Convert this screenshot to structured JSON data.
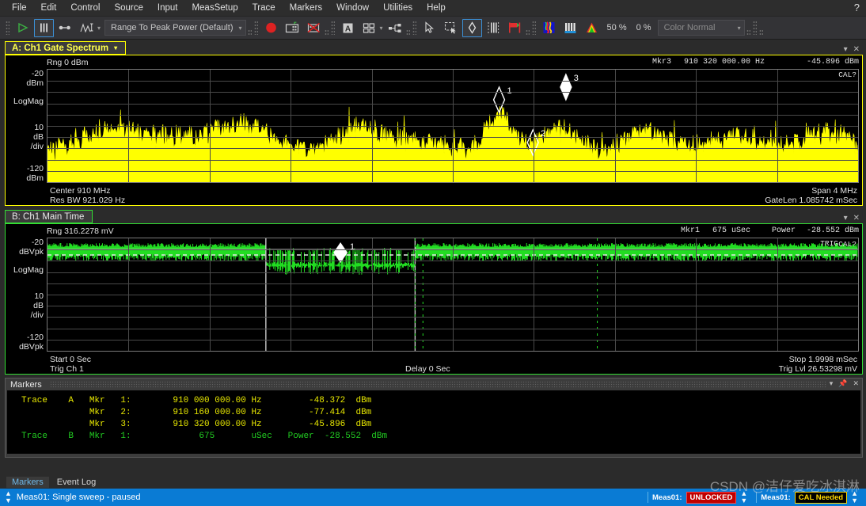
{
  "menu": {
    "items": [
      "File",
      "Edit",
      "Control",
      "Source",
      "Input",
      "MeasSetup",
      "Trace",
      "Markers",
      "Window",
      "Utilities",
      "Help"
    ],
    "help_glyph": "?"
  },
  "toolbar": {
    "play_icon": "play-icon",
    "pause_icon": "pause-icon",
    "single_step_icon": "single-step-icon",
    "range_icon": "autorange-icon",
    "range_dropdown": "Range To Peak Power (Default)",
    "record_icon": "record-icon",
    "capture_icon": "screen-capture-icon",
    "no_capture_icon": "capture-disabled-icon",
    "annotation_icon": "text-annotation-icon",
    "layout_icon": "grid-layout-icon",
    "nodes_icon": "node-network-icon",
    "pointer_icon": "pointer-icon",
    "zoom_box_icon": "zoom-box-icon",
    "marker_icon": "marker-diamond-icon",
    "bars_icon": "bars-icon",
    "gate_icon": "gate-flag-icon",
    "spectrogram_icon": "spectrogram-icon",
    "waterfall_icon": "waterfall-icon",
    "persistence_icon": "persistence-icon",
    "percent_1": "50 %",
    "percent_2": "0 %",
    "color_dropdown": "Color Normal",
    "caret": "▾"
  },
  "panel_a": {
    "tab_label": "A: Ch1 Gate Spectrum",
    "tab_caret": "▾",
    "range": "Rng 0 dBm",
    "marker_readout_label": "Mkr3",
    "marker_readout_freq": "910 320 000.00 Hz",
    "marker_readout_amp": "-45.896 dBm",
    "cal_flag": "CAL?",
    "y_top_1": "-20",
    "y_top_2": "dBm",
    "y_mode": "LogMag",
    "y_div_1": "10",
    "y_div_2": "dB",
    "y_div_3": "/div",
    "y_bot_1": "-120",
    "y_bot_2": "dBm",
    "center": "Center 910 MHz",
    "resbw": "Res BW 921.029  Hz",
    "span": "Span 4 MHz",
    "gatelen": "GateLen 1.085742 mSec",
    "markers": [
      {
        "label": "1",
        "filled": false
      },
      {
        "label": "2",
        "filled": false
      },
      {
        "label": "3",
        "filled": true
      }
    ],
    "minimize_icon": "minimize-icon",
    "close_icon": "close-icon"
  },
  "panel_b": {
    "tab_label": "B: Ch1 Main Time",
    "range": "Rng 316.2278 mV",
    "marker_readout_label": "Mkr1",
    "marker_readout_time": "675 uSec",
    "marker_readout_power_label": "Power",
    "marker_readout_power": "-28.552 dBm",
    "trig_flag": "TRIG",
    "cal_flag": "CAL?",
    "y_top_1": "-20",
    "y_top_2": "dBVpk",
    "y_mode": "LogMag",
    "y_div_1": "10",
    "y_div_2": "dB",
    "y_div_3": "/div",
    "y_bot_1": "-120",
    "y_bot_2": "dBVpk",
    "start": "Start 0  Sec",
    "trig_ch": "Trig Ch 1",
    "delay": "Delay 0  Sec",
    "stop": "Stop 1.9998 mSec",
    "trig_lvl": "Trig Lvl 26.53298 mV",
    "marker_label": "1",
    "minimize_icon": "minimize-icon",
    "close_icon": "close-icon"
  },
  "markers_panel": {
    "title": "Markers",
    "pin_icon": "pin-icon",
    "minimize_icon": "minimize-icon",
    "close_icon": "close-icon",
    "rows": [
      {
        "color": "yellow",
        "text": "Trace    A   Mkr   1:        910 000 000.00 Hz         -48.372  dBm"
      },
      {
        "color": "yellow",
        "text": "             Mkr   2:        910 160 000.00 Hz         -77.414  dBm"
      },
      {
        "color": "yellow",
        "text": "             Mkr   3:        910 320 000.00 Hz         -45.896  dBm"
      },
      {
        "color": "green",
        "text": "Trace    B   Mkr   1:             675       uSec   Power  -28.552  dBm"
      }
    ]
  },
  "bottom_tabs": [
    {
      "label": "Markers",
      "active": true
    },
    {
      "label": "Event Log",
      "active": false
    }
  ],
  "status": {
    "left_text": "Meas01:   Single sweep - paused",
    "updown_icon": "up-down-arrows-icon",
    "badge_1_prefix": "Meas01:",
    "badge_1": "UNLOCKED",
    "badge_2_prefix": "Meas01:",
    "badge_2": "CAL Needed",
    "watermark": "CSDN @洁仔爱吃冰淇淋"
  },
  "colors": {
    "trace_a": "#ffff00",
    "trace_b": "#22dd22",
    "accent": "#0a7bd4",
    "grid": "#4a4a4a",
    "panel_bg": "#2b2b2b"
  }
}
